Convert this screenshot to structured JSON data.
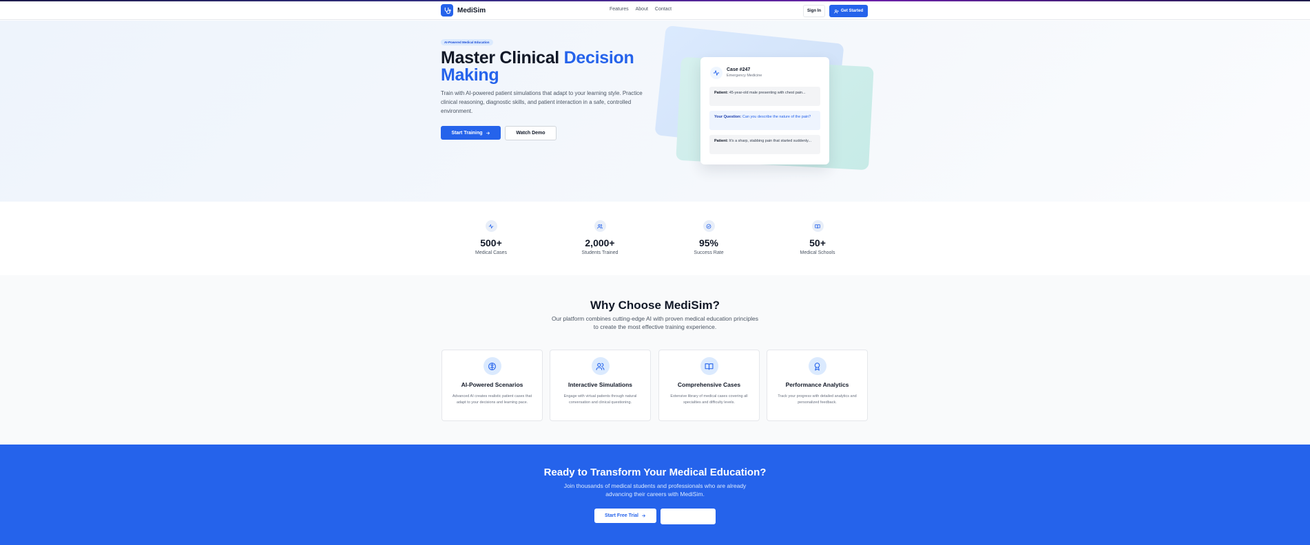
{
  "header": {
    "logo_text": "MediSim",
    "nav": [
      "Features",
      "About",
      "Contact"
    ],
    "sign_in": "Sign In",
    "get_started": "Get Started"
  },
  "hero": {
    "badge": "AI-Powered Medical Education",
    "title_part1": "Master Clinical ",
    "title_accent": "Decision Making",
    "description": "Train with AI-powered patient simulations that adapt to your learning style. Practice clinical reasoning, diagnostic skills, and patient interaction in a safe, controlled environment.",
    "primary_button": "Start Training",
    "secondary_button": "Watch Demo",
    "case_card": {
      "title": "Case #247",
      "subtitle": "Emergency Medicine",
      "messages": [
        {
          "speaker": "Patient:",
          "text": "45-year-old male presenting with chest pain..."
        },
        {
          "speaker": "Your Question:",
          "text": "Can you describe the nature of the pain?"
        },
        {
          "speaker": "Patient:",
          "text": "It's a sharp, stabbing pain that started suddenly..."
        }
      ]
    }
  },
  "stats": [
    {
      "icon": "activity-icon",
      "value": "500+",
      "label": "Medical Cases"
    },
    {
      "icon": "users-icon",
      "value": "2,000+",
      "label": "Students Trained"
    },
    {
      "icon": "check-circle-icon",
      "value": "95%",
      "label": "Success Rate"
    },
    {
      "icon": "book-icon",
      "value": "50+",
      "label": "Medical Schools"
    }
  ],
  "features": {
    "title": "Why Choose MediSim?",
    "subtitle": "Our platform combines cutting-edge AI with proven medical education principles to create the most effective training experience.",
    "cards": [
      {
        "icon": "brain-icon",
        "title": "AI-Powered Scenarios",
        "description": "Advanced AI creates realistic patient cases that adapt to your decisions and learning pace."
      },
      {
        "icon": "users-icon",
        "title": "Interactive Simulations",
        "description": "Engage with virtual patients through natural conversation and clinical questioning."
      },
      {
        "icon": "book-open-icon",
        "title": "Comprehensive Cases",
        "description": "Extensive library of medical cases covering all specialties and difficulty levels."
      },
      {
        "icon": "award-icon",
        "title": "Performance Analytics",
        "description": "Track your progress with detailed analytics and personalized feedback."
      }
    ]
  },
  "cta": {
    "title": "Ready to Transform Your Medical Education?",
    "subtitle": "Join thousands of medical students and professionals who are already advancing their careers with MediSim.",
    "trial_button": "Start Free Trial"
  },
  "colors": {
    "primary": "#2563eb",
    "text": "#111827",
    "muted": "#4b5563"
  }
}
